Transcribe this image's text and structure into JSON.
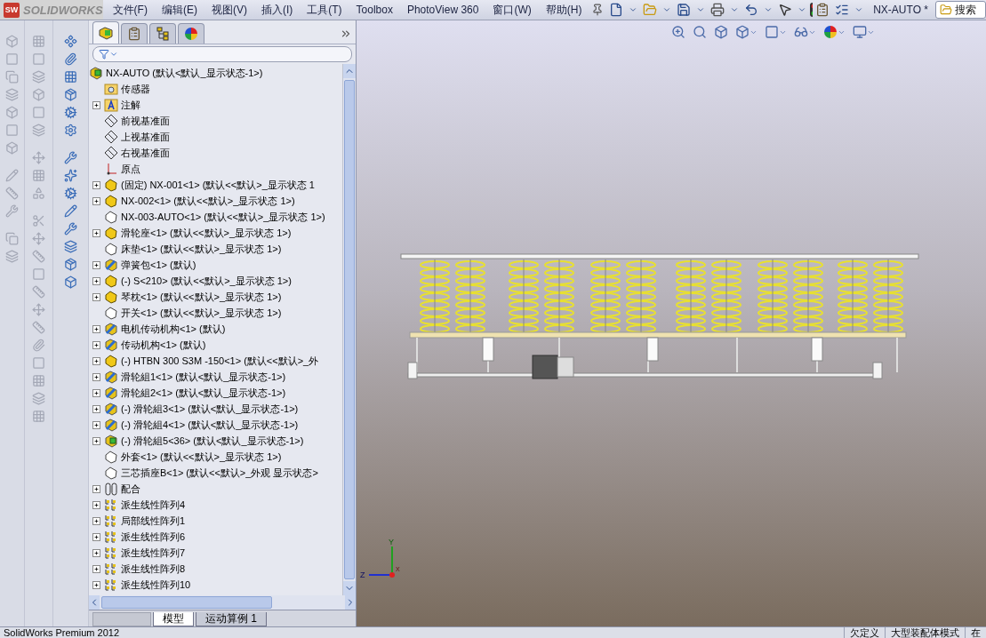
{
  "title_bar": {
    "logo_badge": "SW",
    "logo_text": "SOLIDWORKS",
    "menu": [
      "文件(F)",
      "编辑(E)",
      "视图(V)",
      "插入(I)",
      "工具(T)",
      "Toolbox",
      "PhotoView 360",
      "窗口(W)",
      "帮助(H)"
    ],
    "document": "NX-AUTO *",
    "search": {
      "placeholder": "搜索"
    }
  },
  "panel_tabs": [
    {
      "kind": "feature-tree",
      "selected": true
    },
    {
      "kind": "property",
      "selected": false
    },
    {
      "kind": "configuration",
      "selected": false
    },
    {
      "kind": "appearance",
      "selected": false
    }
  ],
  "tree": {
    "label": "NX-AUTO  (默认<默认_显示状态-1>)",
    "kind": "assembly",
    "children": [
      {
        "label": "传感器",
        "kind": "sensor-folder"
      },
      {
        "label": "注解",
        "kind": "annotation-folder",
        "expanded": false
      },
      {
        "label": "前视基准面",
        "kind": "plane"
      },
      {
        "label": "上视基准面",
        "kind": "plane"
      },
      {
        "label": "右视基准面",
        "kind": "plane"
      },
      {
        "label": "原点",
        "kind": "origin"
      },
      {
        "label": "(固定) NX-001<1> (默认<<默认>_显示状态 1",
        "kind": "part",
        "expanded": false
      },
      {
        "label": "NX-002<1> (默认<<默认>_显示状态 1>)",
        "kind": "part",
        "expanded": false
      },
      {
        "label": "NX-003-AUTO<1> (默认<<默认>_显示状态 1>)",
        "kind": "part-outline"
      },
      {
        "label": "滑轮座<1> (默认<<默认>_显示状态 1>)",
        "kind": "part",
        "expanded": false
      },
      {
        "label": "床垫<1> (默认<<默认>_显示状态 1>)",
        "kind": "part-outline"
      },
      {
        "label": "弹簧包<1> (默认)",
        "kind": "subassembly",
        "expanded": false
      },
      {
        "label": "(-) S<210> (默认<<默认>_显示状态 1>)",
        "kind": "part",
        "expanded": false
      },
      {
        "label": "琴枕<1> (默认<<默认>_显示状态 1>)",
        "kind": "part",
        "expanded": false
      },
      {
        "label": "开关<1> (默认<<默认>_显示状态 1>)",
        "kind": "part-outline"
      },
      {
        "label": "电机传动机构<1> (默认)",
        "kind": "subassembly",
        "expanded": false
      },
      {
        "label": "传动机构<1> (默认)",
        "kind": "subassembly",
        "expanded": false
      },
      {
        "label": "(-) HTBN 300 S3M -150<1> (默认<<默认>_外",
        "kind": "part",
        "expanded": false
      },
      {
        "label": "滑轮組1<1> (默认<默认_显示状态-1>)",
        "kind": "subassembly",
        "expanded": false
      },
      {
        "label": "滑轮組2<1> (默认<默认_显示状态-1>)",
        "kind": "subassembly",
        "expanded": false
      },
      {
        "label": "(-) 滑轮組3<1> (默认<默认_显示状态-1>)",
        "kind": "subassembly",
        "expanded": false
      },
      {
        "label": "(-) 滑轮組4<1> (默认<默认_显示状态-1>)",
        "kind": "subassembly",
        "expanded": false
      },
      {
        "label": "(-) 滑轮組5<36> (默认<默认_显示状态-1>)",
        "kind": "assembly",
        "expanded": false
      },
      {
        "label": "外套<1> (默认<<默认>_显示状态 1>)",
        "kind": "part-outline"
      },
      {
        "label": "三芯插座B<1> (默认<<默认>_外观 显示状态>",
        "kind": "part-outline"
      },
      {
        "label": "配合",
        "kind": "mates",
        "expanded": false
      },
      {
        "label": "派生线性阵列4",
        "kind": "pattern",
        "expanded": false
      },
      {
        "label": "局部线性阵列1",
        "kind": "pattern",
        "expanded": false
      },
      {
        "label": "派生线性阵列6",
        "kind": "pattern",
        "expanded": false
      },
      {
        "label": "派生线性阵列7",
        "kind": "pattern",
        "expanded": false
      },
      {
        "label": "派生线性阵列8",
        "kind": "pattern",
        "expanded": false
      },
      {
        "label": "派生线性阵列10",
        "kind": "pattern",
        "expanded": false
      }
    ]
  },
  "bottom_tabs": [
    {
      "label": "模型",
      "selected": true
    },
    {
      "label": "运动算例 1",
      "selected": false
    }
  ],
  "triad": {
    "x": "X",
    "y": "Y",
    "z": "Z"
  },
  "status_bar": {
    "product": "SolidWorks Premium 2012",
    "segments": [
      "欠定义",
      "大型装配体模式",
      "在"
    ]
  }
}
